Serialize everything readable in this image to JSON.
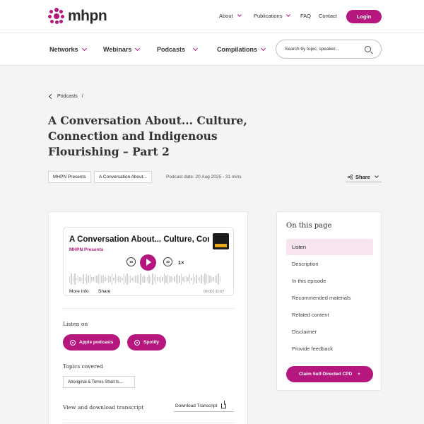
{
  "brand": {
    "name": "mhpn",
    "accent": "#b5177e"
  },
  "topnav": {
    "about": "About",
    "publications": "Publications",
    "faq": "FAQ",
    "contact": "Contact",
    "login": "Login"
  },
  "secnav": {
    "networks": "Networks",
    "webinars": "Webinars",
    "podcasts": "Podcasts",
    "compilations": "Compilations"
  },
  "search": {
    "placeholder": "Search by topic, speaker..."
  },
  "breadcrumb": {
    "item": "Podcasts",
    "sep": "/"
  },
  "page": {
    "title": "A Conversation About... Culture, Connection and Indigenous Flourishing – Part 2",
    "tags": [
      "MHPN Presents",
      "A Conversation About..."
    ],
    "podcast_date": "Podcast date: 20 Aug 2025 - 31 mins",
    "share": "Share"
  },
  "player": {
    "title": "A Conversation About... Culture, Connection and Indigenous",
    "subtitle": "MHPN Presents",
    "skip_back": "15",
    "skip_fwd": "30",
    "speed": "1×",
    "more_info": "More Info",
    "share": "Share",
    "time": "00:00 | 31:07"
  },
  "listen": {
    "label": "Listen on",
    "apple": "Apple podcasts",
    "spotify": "Spotify"
  },
  "topics": {
    "label": "Topics covered",
    "items": [
      "Aboriginal & Torres Strait Is..."
    ]
  },
  "transcript": {
    "label": "View and download transcript",
    "link": "Download Transcript"
  },
  "sidebar": {
    "title": "On this page",
    "items": [
      "Listen",
      "Description",
      "In this episode",
      "Recommended materials",
      "Related content",
      "Disclaimer",
      "Provide feedback"
    ],
    "cpd": "Claim Self-Directed CPD",
    "cpd_icon": "+"
  }
}
